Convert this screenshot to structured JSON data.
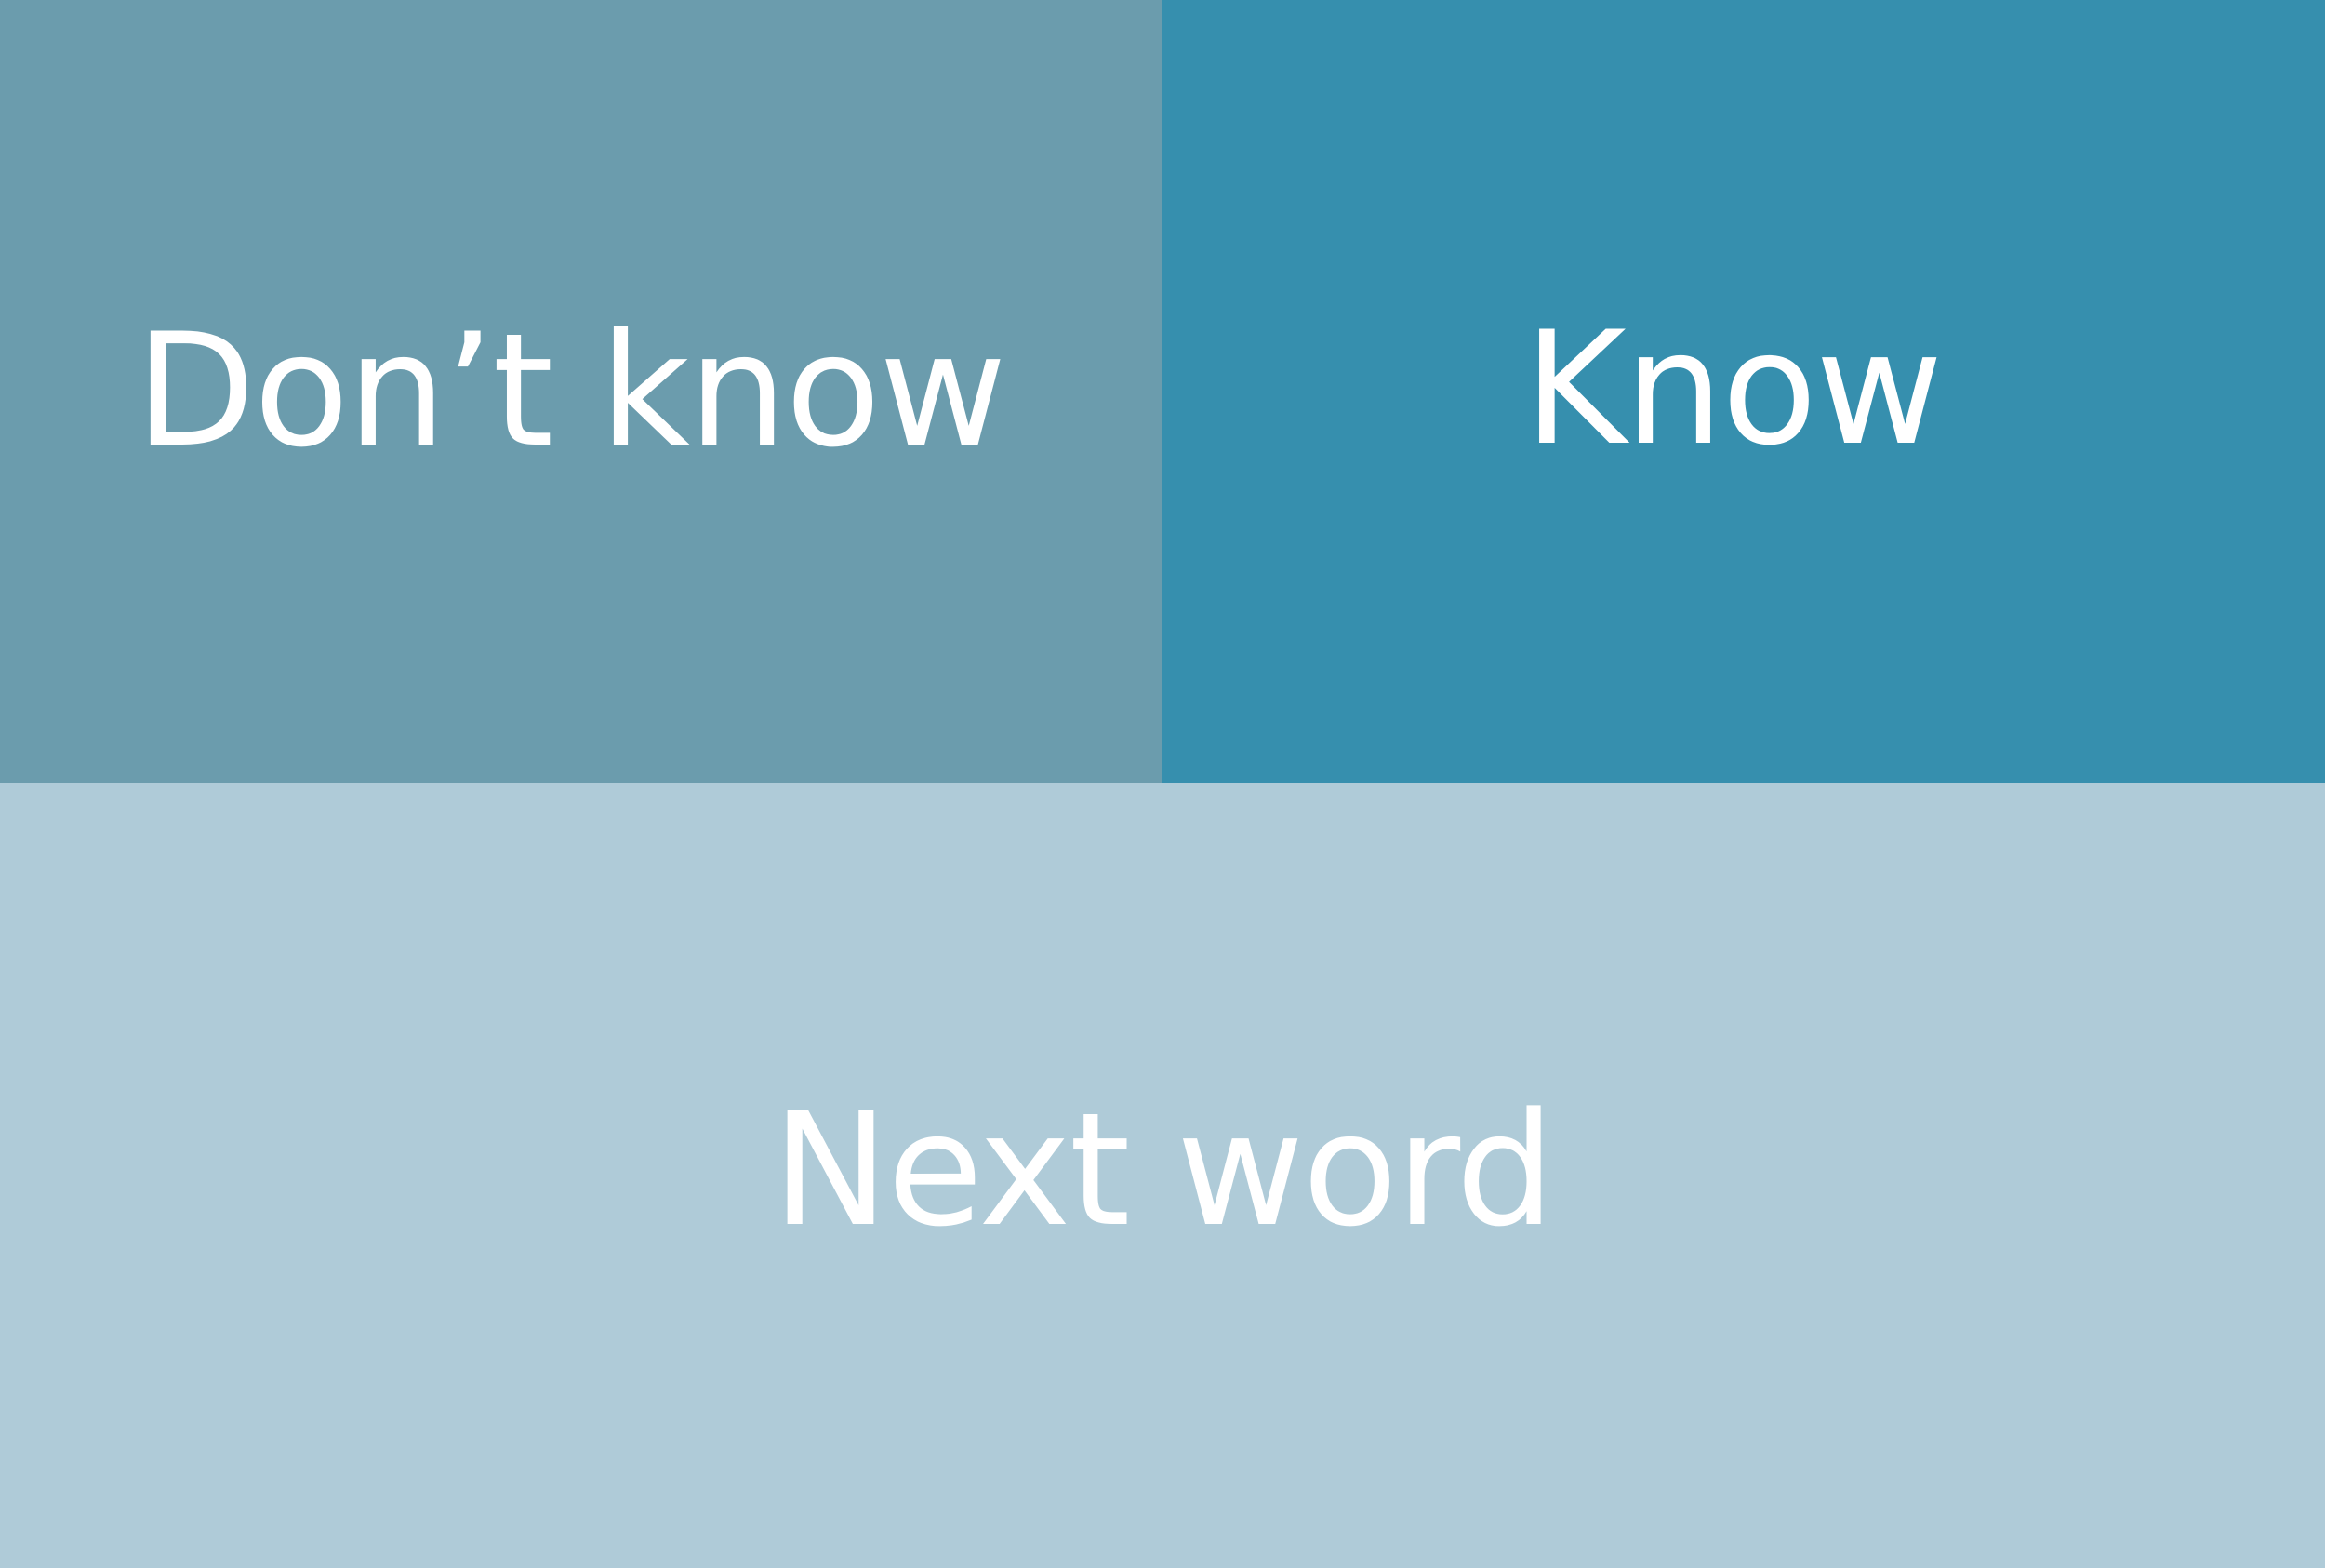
{
  "buttons": {
    "dont_know": {
      "label": "Don’t know",
      "color": "#6b9cad"
    },
    "know": {
      "label": "Know",
      "color": "#368fae"
    },
    "next_word": {
      "label": "Next word",
      "color": "#afcbd8"
    }
  },
  "text_color": "#ffffff"
}
